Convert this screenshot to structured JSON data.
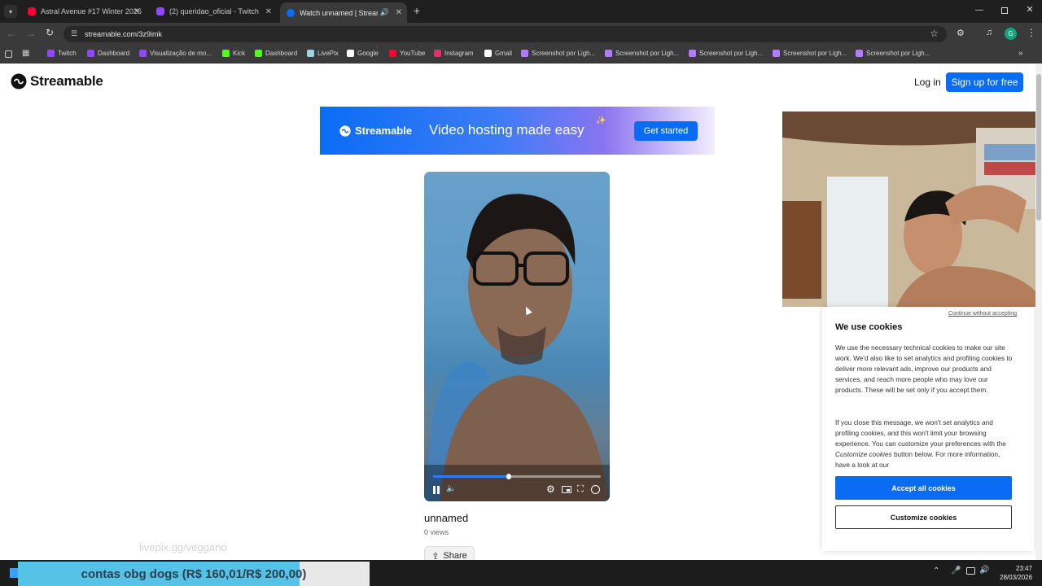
{
  "browser": {
    "tabs": [
      {
        "title": "Astral Avenue #17 Winter 2026",
        "favicon_color": "#ff0033"
      },
      {
        "title": "(2) queridao_oficial - Twitch",
        "favicon_color": "#9146ff"
      },
      {
        "title": "Watch unnamed | Streamable",
        "favicon_color": "#0a6cf5"
      }
    ],
    "url": "streamable.com/3z9imk",
    "bookmarks": [
      {
        "label": "Twitch",
        "color": "#9146ff"
      },
      {
        "label": "Dashboard",
        "color": "#9146ff"
      },
      {
        "label": "Visualização de mo...",
        "color": "#9146ff"
      },
      {
        "label": "Kick",
        "color": "#53fc18"
      },
      {
        "label": "Dashboard",
        "color": "#53fc18"
      },
      {
        "label": "LivePix",
        "color": "#9fd4e0"
      },
      {
        "label": "Google",
        "color": "#ffffff"
      },
      {
        "label": "YouTube",
        "color": "#ff0033"
      },
      {
        "label": "Instagram",
        "color": "#e1306c"
      },
      {
        "label": "Gmail",
        "color": "#ffffff"
      },
      {
        "label": "Screenshot por Ligh...",
        "color": "#b37cff"
      },
      {
        "label": "Screenshot por Ligh...",
        "color": "#b37cff"
      },
      {
        "label": "Screenshot por Ligh...",
        "color": "#b37cff"
      },
      {
        "label": "Screenshot por Ligh...",
        "color": "#b37cff"
      },
      {
        "label": "Screenshot por Ligh...",
        "color": "#b37cff"
      }
    ],
    "profile_initial": "G"
  },
  "site": {
    "brand": "Streamable",
    "login": "Log in",
    "signup": "Sign up for free",
    "accent": "#0a6cf5"
  },
  "banner": {
    "brand": "Streamable",
    "tagline": "Video hosting made easy",
    "cta": "Get started"
  },
  "video": {
    "title": "unnamed",
    "views": "0 views",
    "share": "Share",
    "progress": 0.45
  },
  "cookies": {
    "skip": "Continue without accepting",
    "heading": "We use cookies",
    "para1": "We use the necessary technical cookies to make our site work. We'd also like to set analytics and profiling cookies to deliver more relevant ads, improve our products and services, and reach more people who may love our products. These will be set only if you accept them.",
    "para2_a": "If you close this message, we won't set analytics and profiling cookies, and this won't limit your browsing experience. You can customize your preferences with the ",
    "para2_em": "Customize cookies",
    "para2_b": " button below. For more information, have a look at our",
    "accept": "Accept all cookies",
    "customize": "Customize cookies"
  },
  "overlay": {
    "livepix_url": "livepix.gg/veggano",
    "donation_text": "contas obg dogs (R$ 160,01/R$ 200,00)",
    "donation_progress": 0.8
  },
  "taskbar": {
    "time": "23:47",
    "date": "28/03/2026"
  }
}
